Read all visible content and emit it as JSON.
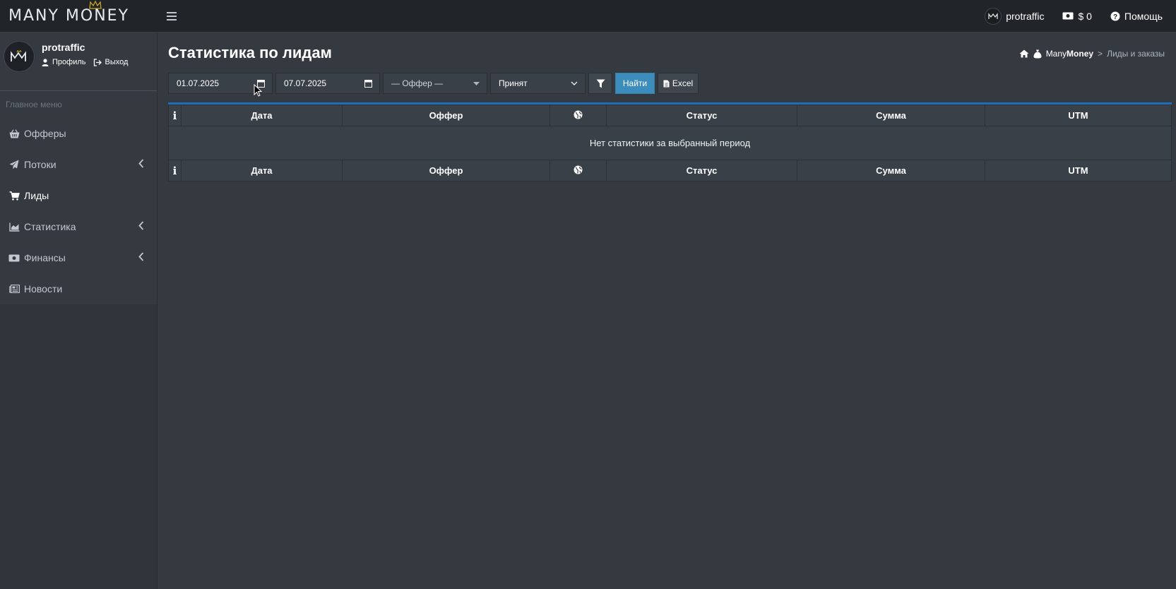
{
  "brand": {
    "logo_text": "MANY MONEY"
  },
  "topbar": {
    "username": "protraffic",
    "balance": "$ 0",
    "help": "Помощь"
  },
  "sidebar": {
    "username": "protraffic",
    "profile_link": "Профиль",
    "logout_link": "Выход",
    "menu_header": "Главное меню",
    "items": [
      {
        "label": "Офферы",
        "icon": "basket-icon",
        "has_children": false,
        "active": false
      },
      {
        "label": "Потоки",
        "icon": "paper-plane-icon",
        "has_children": true,
        "active": false
      },
      {
        "label": "Лиды",
        "icon": "cart-icon",
        "has_children": false,
        "active": true
      },
      {
        "label": "Статистика",
        "icon": "chart-area-icon",
        "has_children": true,
        "active": false
      },
      {
        "label": "Финансы",
        "icon": "money-bill-icon",
        "has_children": true,
        "active": false
      },
      {
        "label": "Новости",
        "icon": "newspaper-icon",
        "has_children": false,
        "active": false
      }
    ]
  },
  "page": {
    "title": "Статистика по лидам",
    "breadcrumb": {
      "root_light": "Many",
      "root_bold": "Money",
      "separator": ">",
      "current": "Лиды и заказы"
    }
  },
  "filters": {
    "date_from": "01.07.2025",
    "date_to": "07.07.2025",
    "offer_placeholder": "— Оффер —",
    "status_selected": "Принят",
    "find_button": "Найти",
    "excel_button": "Excel"
  },
  "table": {
    "columns": [
      "i",
      "Дата",
      "Оффер",
      "globe-icon",
      "Статус",
      "Сумма",
      "UTM"
    ],
    "col_date": "Дата",
    "col_offer": "Оффер",
    "col_status": "Статус",
    "col_sum": "Сумма",
    "col_utm": "UTM",
    "col_info": "i",
    "empty_message": "Нет статистики за выбранный период"
  },
  "colors": {
    "topbar_bg": "#212529",
    "content_bg": "#343a40",
    "accent_blue": "#3c8dbc",
    "card_top_border": "#1f6eb8"
  }
}
